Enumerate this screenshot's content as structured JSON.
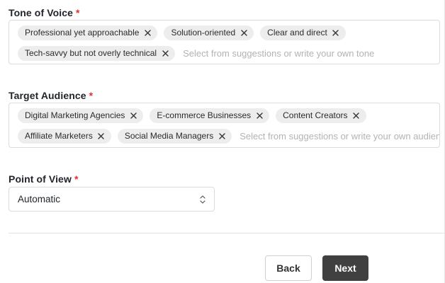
{
  "tone": {
    "label": "Tone of Voice",
    "required_mark": "*",
    "tags": [
      "Professional yet approachable",
      "Solution-oriented",
      "Clear and direct",
      "Tech-savvy but not overly technical"
    ],
    "placeholder": "Select from suggestions or write your own tone"
  },
  "audience": {
    "label": "Target Audience",
    "required_mark": "*",
    "tags": [
      "Digital Marketing Agencies",
      "E-commerce Businesses",
      "Content Creators",
      "Affiliate Marketers",
      "Social Media Managers"
    ],
    "placeholder": "Select from suggestions or write your own audience"
  },
  "pov": {
    "label": "Point of View",
    "required_mark": "*",
    "value": "Automatic",
    "icon": "chevron-up-down-icon"
  },
  "footer": {
    "back_label": "Back",
    "next_label": "Next"
  },
  "colors": {
    "required": "#e03131",
    "chip_bg": "#ededed",
    "primary_button": "#404040"
  }
}
